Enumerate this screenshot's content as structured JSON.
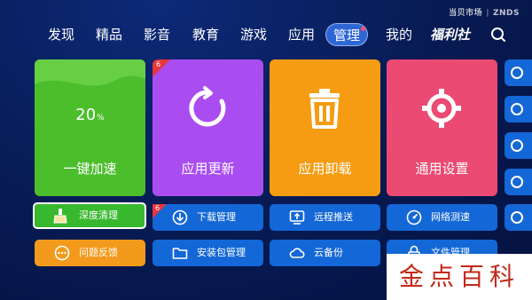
{
  "brand": {
    "store": "当贝市场",
    "logo": "ZNDS"
  },
  "nav": {
    "items": [
      {
        "label": "发现"
      },
      {
        "label": "精品"
      },
      {
        "label": "影音"
      },
      {
        "label": "教育"
      },
      {
        "label": "游戏"
      },
      {
        "label": "应用"
      },
      {
        "label": "管理"
      },
      {
        "label": "我的"
      },
      {
        "label": "福利社"
      }
    ],
    "active": "管理"
  },
  "tiles": {
    "speedup": {
      "label": "一键加速",
      "value": "20",
      "unit": "%"
    },
    "update": {
      "label": "应用更新",
      "badge": "6"
    },
    "uninstall": {
      "label": "应用卸载"
    },
    "settings": {
      "label": "通用设置"
    }
  },
  "buttons": {
    "deep_clean": "深度清理",
    "download_mgmt": "下载管理",
    "download_badge": "6",
    "remote_push": "远程推送",
    "net_speed": "网络测速",
    "feedback": "问题反馈",
    "pkg_mgmt": "安装包管理",
    "cloud_backup": "云备份",
    "file_mgmt": "文件管理"
  },
  "watermark": "金点百科",
  "colors": {
    "green": "#4cbe2c",
    "purple": "#a94df1",
    "orange": "#f59c12",
    "pink": "#eb4a72",
    "blue": "#1467d6",
    "accent": "#2e66d6"
  }
}
